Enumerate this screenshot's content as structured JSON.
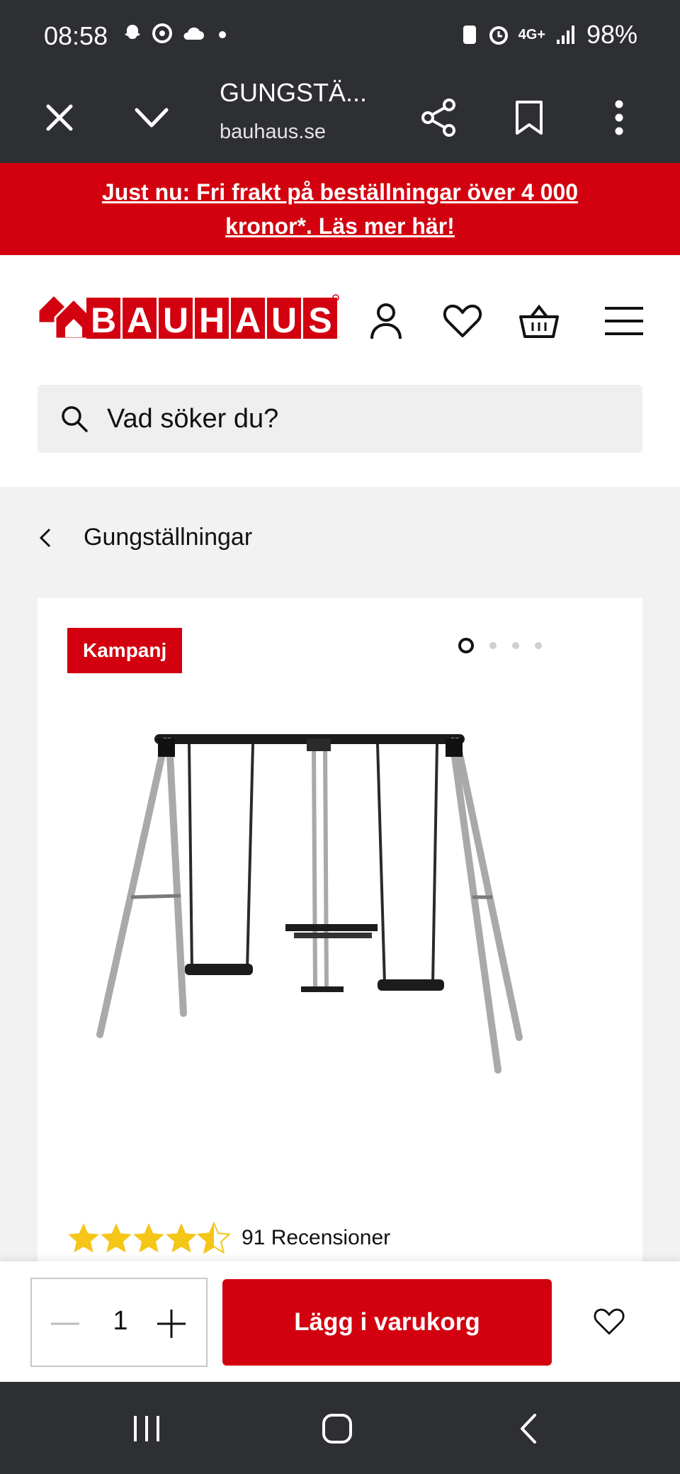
{
  "status_bar": {
    "time": "08:58",
    "network": "4G+",
    "battery": "98%"
  },
  "browser": {
    "title": "GUNGSTÄ...",
    "url": "bauhaus.se"
  },
  "promo": {
    "text": "Just nu: Fri frakt på beställningar över 4 000 kronor*. Läs mer här!"
  },
  "header": {
    "logo_text": "BAUHAUS",
    "search_placeholder": "Vad söker du?"
  },
  "breadcrumb": {
    "label": "Gungställningar"
  },
  "product": {
    "badge": "Kampanj",
    "gallery_count": 4,
    "gallery_active_index": 0,
    "rating_stars": 4.5,
    "reviews_label": "91 Recensioner"
  },
  "buy_bar": {
    "quantity": "1",
    "add_to_cart_label": "Lägg i varukorg"
  },
  "colors": {
    "brand_red": "#d3000f",
    "dark_bar": "#2e2f33",
    "star": "#f5c518"
  }
}
